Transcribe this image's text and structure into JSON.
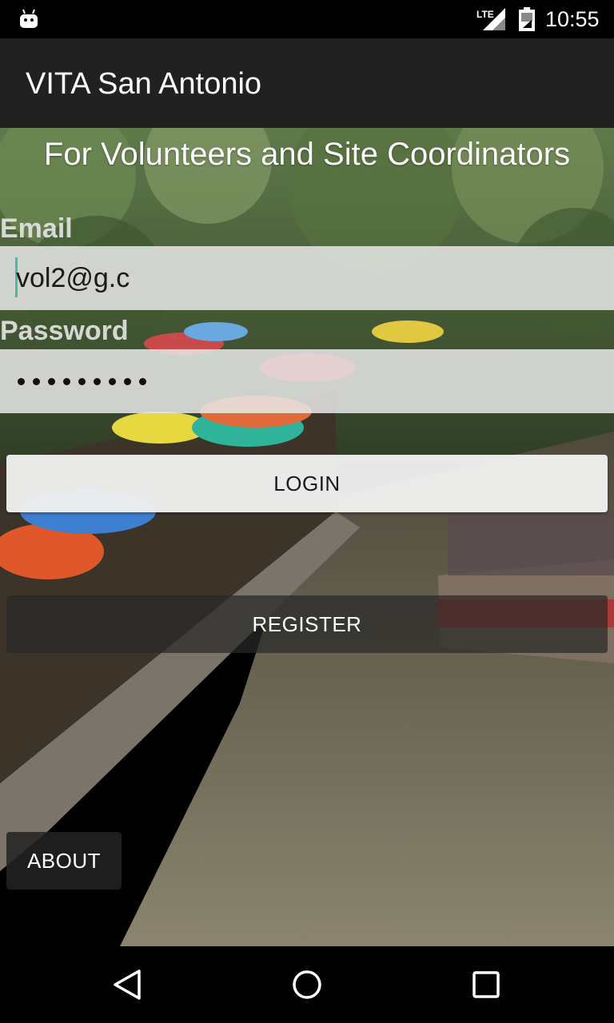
{
  "status_bar": {
    "time": "10:55",
    "network": "LTE",
    "icons": [
      "android-icon",
      "lte-signal-icon",
      "battery-icon"
    ]
  },
  "app_bar": {
    "title": "VITA San Antonio"
  },
  "main": {
    "subtitle": "For Volunteers and Site Coordinators",
    "email": {
      "label": "Email",
      "value": "vol2@g.c"
    },
    "password": {
      "label": "Password",
      "masked_length": 9
    },
    "login_label": "LOGIN",
    "register_label": "REGISTER",
    "about_label": "ABOUT"
  },
  "nav_bar": {
    "icons": [
      "back-icon",
      "home-icon",
      "recents-icon"
    ]
  },
  "colors": {
    "app_bar": "#212121",
    "status_bar": "#000000",
    "cursor_accent": "#4db6ac"
  }
}
